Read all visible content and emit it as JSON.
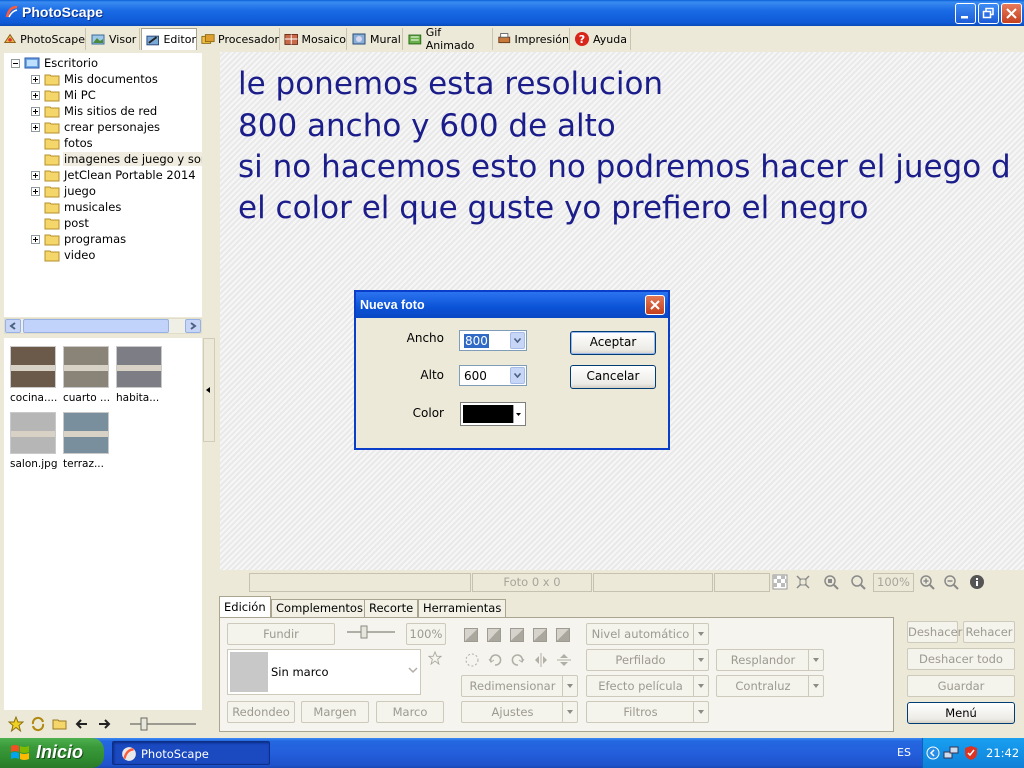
{
  "window": {
    "title": "PhotoScape"
  },
  "top_tabs": [
    {
      "label": "PhotoScape",
      "icon": "photoscape-icon"
    },
    {
      "label": "Visor",
      "icon": "viewer-icon"
    },
    {
      "label": "Editor",
      "icon": "editor-icon",
      "active": true
    },
    {
      "label": "Procesador",
      "icon": "batch-icon"
    },
    {
      "label": "Mosaico",
      "icon": "mosaic-icon"
    },
    {
      "label": "Mural",
      "icon": "mural-icon"
    },
    {
      "label": "Gif Animado",
      "icon": "gif-icon"
    },
    {
      "label": "Impresión",
      "icon": "print-icon"
    },
    {
      "label": "Ayuda",
      "icon": "help-icon"
    }
  ],
  "tree": {
    "root": "Escritorio",
    "items": [
      {
        "label": "Mis documentos",
        "expandable": true
      },
      {
        "label": "Mi PC",
        "expandable": true
      },
      {
        "label": "Mis sitios de red",
        "expandable": true
      },
      {
        "label": "crear personajes",
        "expandable": true
      },
      {
        "label": "fotos",
        "expandable": false
      },
      {
        "label": "imagenes de juego y son",
        "expandable": false,
        "selected": true
      },
      {
        "label": "JetClean Portable 2014",
        "expandable": true
      },
      {
        "label": "juego",
        "expandable": true
      },
      {
        "label": "musicales",
        "expandable": false
      },
      {
        "label": "post",
        "expandable": false
      },
      {
        "label": "programas",
        "expandable": true
      },
      {
        "label": "video",
        "expandable": false
      }
    ]
  },
  "thumbnails": [
    {
      "label": "cocina....",
      "color": "#6b5a4a"
    },
    {
      "label": "cuarto ...",
      "color": "#8a8378"
    },
    {
      "label": "habita...",
      "color": "#7d7d86"
    },
    {
      "label": "salon.jpg",
      "color": "#b6b6b6"
    },
    {
      "label": "terraz...",
      "color": "#7a8f9e"
    }
  ],
  "canvas": {
    "overlay_lines": [
      "le ponemos esta resolucion",
      "800 ancho y 600 de alto",
      "si no hacemos esto no podremos hacer el juego d",
      "el color el que guste yo prefiero el negro"
    ],
    "overlay_color": "#1b1d8a"
  },
  "dialog": {
    "title": "Nueva foto",
    "ancho_label": "Ancho",
    "ancho_value": "800",
    "alto_label": "Alto",
    "alto_value": "600",
    "color_label": "Color",
    "color_value": "#000000",
    "ok_label": "Aceptar",
    "cancel_label": "Cancelar"
  },
  "status": {
    "photo_info": "Foto 0 x 0",
    "zoom": "100%"
  },
  "bottom_tabs": [
    {
      "label": "Edición",
      "active": true
    },
    {
      "label": "Complementos"
    },
    {
      "label": "Recorte"
    },
    {
      "label": "Herramientas"
    }
  ],
  "edit_panel": {
    "fundir": "Fundir",
    "zoom_value": "100%",
    "frame_value": "Sin marco",
    "redondeo": "Redondeo",
    "margen": "Margen",
    "marco": "Marco",
    "nivel_auto": "Nivel automático",
    "perfilado": "Perfilado",
    "resplandor": "Resplandor",
    "redimensionar": "Redimensionar",
    "efecto_pelicula": "Efecto película",
    "contraluz": "Contraluz",
    "ajustes": "Ajustes",
    "filtros": "Filtros"
  },
  "right_buttons": {
    "deshacer": "Deshacer",
    "rehacer": "Rehacer",
    "deshacer_todo": "Deshacer todo",
    "guardar": "Guardar",
    "menu": "Menú"
  },
  "taskbar": {
    "start": "Inicio",
    "task_item": "PhotoScape",
    "language": "ES",
    "clock": "21:42"
  }
}
